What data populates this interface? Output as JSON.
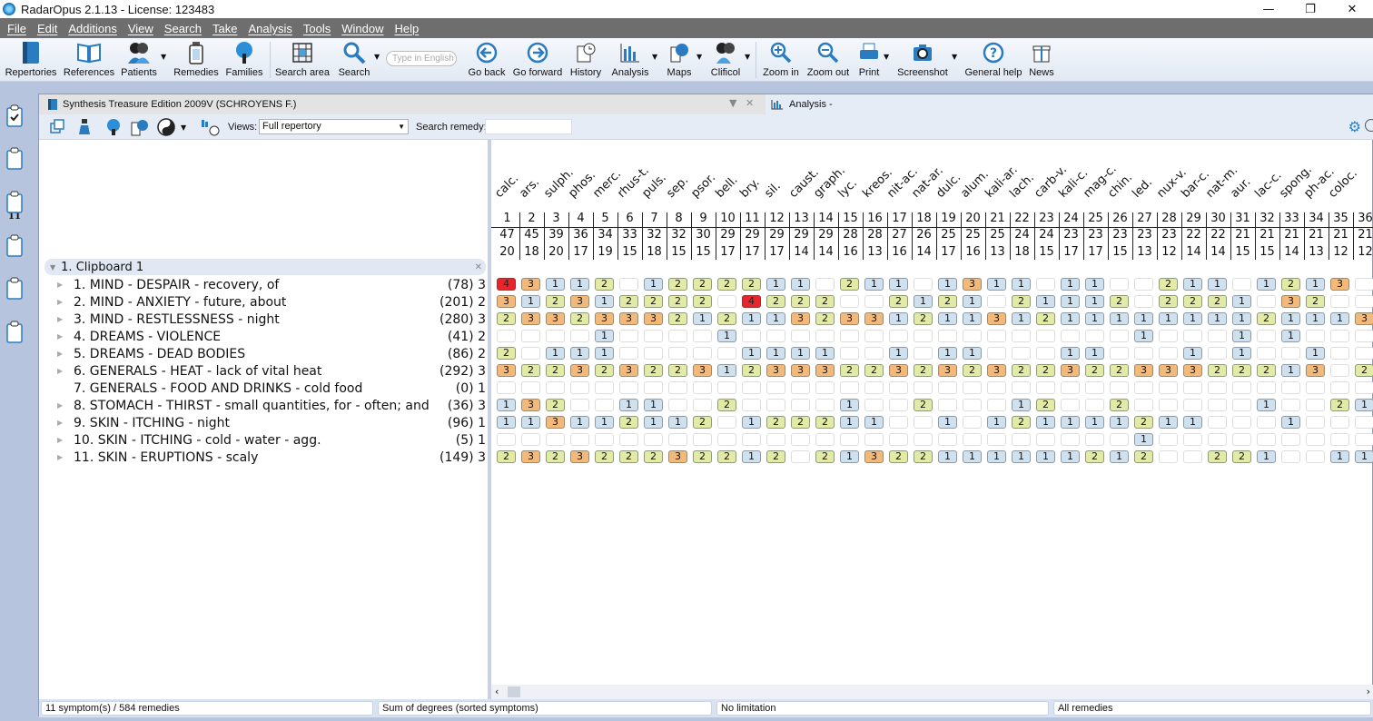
{
  "app": {
    "title": "RadarOpus 2.1.13 - License: 123483"
  },
  "window_controls": {
    "minimize": "—",
    "restore": "❐",
    "close": "✕"
  },
  "menu": [
    "File",
    "Edit",
    "Additions",
    "View",
    "Search",
    "Take",
    "Analysis",
    "Tools",
    "Window",
    "Help"
  ],
  "toolbar": {
    "buttons": [
      {
        "label": "Repertories",
        "icon": "book-icon"
      },
      {
        "label": "References",
        "icon": "open-book-icon"
      },
      {
        "label": "Patients",
        "icon": "patients-icon"
      },
      {
        "label": "Remedies",
        "icon": "remedy-jar-icon"
      },
      {
        "label": "Families",
        "icon": "tree-icon"
      },
      {
        "label": "Search area",
        "icon": "search-area-icon"
      },
      {
        "label": "Search",
        "icon": "search-icon"
      },
      {
        "label": "Go back",
        "icon": "arrow-left-icon"
      },
      {
        "label": "Go forward",
        "icon": "arrow-right-icon"
      },
      {
        "label": "History",
        "icon": "history-icon"
      },
      {
        "label": "Analysis",
        "icon": "bar-chart-icon"
      },
      {
        "label": "Maps",
        "icon": "maps-icon"
      },
      {
        "label": "Clificol",
        "icon": "clificol-icon"
      },
      {
        "label": "Zoom in",
        "icon": "zoom-in-icon"
      },
      {
        "label": "Zoom out",
        "icon": "zoom-out-icon"
      },
      {
        "label": "Print",
        "icon": "printer-icon"
      },
      {
        "label": "Screenshot",
        "icon": "camera-icon"
      },
      {
        "label": "General help",
        "icon": "help-icon"
      },
      {
        "label": "News",
        "icon": "gift-icon"
      }
    ],
    "search_placeholder": "Type in English"
  },
  "sidebar": {
    "clipboard_count": "11"
  },
  "tabs": {
    "repertory": "Synthesis Treasure Edition 2009V (SCHROYENS F.)",
    "analysis": "Analysis -"
  },
  "subtoolbar": {
    "views_label": "Views:",
    "views_value": "Full repertory",
    "search_remedy_label": "Search remedy:",
    "search_remedy_value": ""
  },
  "clipboard": {
    "title": "1. Clipboard 1"
  },
  "symptoms": [
    {
      "name": "1. MIND - DESPAIR - recovery, of",
      "count": "(78) 3",
      "expandable": true
    },
    {
      "name": "2. MIND - ANXIETY - future, about",
      "count": "(201) 2",
      "expandable": true
    },
    {
      "name": "3. MIND - RESTLESSNESS - night",
      "count": "(280) 3",
      "expandable": true
    },
    {
      "name": "4. DREAMS - VIOLENCE",
      "count": "(41) 2",
      "expandable": true
    },
    {
      "name": "5. DREAMS - DEAD BODIES",
      "count": "(86) 2",
      "expandable": true
    },
    {
      "name": "6. GENERALS - HEAT - lack of vital heat",
      "count": "(292) 3",
      "expandable": true
    },
    {
      "name": "7. GENERALS - FOOD AND DRINKS - cold food",
      "count": "(0) 1",
      "expandable": false
    },
    {
      "name": "8. STOMACH - THIRST - small quantities, for - often; and",
      "count": "(36) 3",
      "expandable": true
    },
    {
      "name": "9. SKIN - ITCHING - night",
      "count": "(96) 1",
      "expandable": true
    },
    {
      "name": "10. SKIN - ITCHING - cold - water - agg.",
      "count": "(5) 1",
      "expandable": true
    },
    {
      "name": "11. SKIN - ERUPTIONS - scaly",
      "count": "(149) 3",
      "expandable": true
    }
  ],
  "remedies": [
    {
      "abbr": "calc.",
      "rank": "1",
      "score": "47",
      "hits": "20"
    },
    {
      "abbr": "ars.",
      "rank": "2",
      "score": "45",
      "hits": "18"
    },
    {
      "abbr": "sulph.",
      "rank": "3",
      "score": "39",
      "hits": "20"
    },
    {
      "abbr": "phos.",
      "rank": "4",
      "score": "36",
      "hits": "17"
    },
    {
      "abbr": "merc.",
      "rank": "5",
      "score": "34",
      "hits": "19"
    },
    {
      "abbr": "rhus-t.",
      "rank": "6",
      "score": "33",
      "hits": "15"
    },
    {
      "abbr": "puls.",
      "rank": "7",
      "score": "32",
      "hits": "18"
    },
    {
      "abbr": "sep.",
      "rank": "8",
      "score": "32",
      "hits": "15"
    },
    {
      "abbr": "psor.",
      "rank": "9",
      "score": "30",
      "hits": "15"
    },
    {
      "abbr": "bell.",
      "rank": "10",
      "score": "29",
      "hits": "17"
    },
    {
      "abbr": "bry.",
      "rank": "11",
      "score": "29",
      "hits": "17"
    },
    {
      "abbr": "sil.",
      "rank": "12",
      "score": "29",
      "hits": "17"
    },
    {
      "abbr": "caust.",
      "rank": "13",
      "score": "29",
      "hits": "14"
    },
    {
      "abbr": "graph.",
      "rank": "14",
      "score": "29",
      "hits": "14"
    },
    {
      "abbr": "lyc.",
      "rank": "15",
      "score": "28",
      "hits": "16"
    },
    {
      "abbr": "kreos.",
      "rank": "16",
      "score": "28",
      "hits": "13"
    },
    {
      "abbr": "nit-ac.",
      "rank": "17",
      "score": "27",
      "hits": "16"
    },
    {
      "abbr": "nat-ar.",
      "rank": "18",
      "score": "26",
      "hits": "14"
    },
    {
      "abbr": "dulc.",
      "rank": "19",
      "score": "25",
      "hits": "17"
    },
    {
      "abbr": "alum.",
      "rank": "20",
      "score": "25",
      "hits": "16"
    },
    {
      "abbr": "kali-ar.",
      "rank": "21",
      "score": "25",
      "hits": "13"
    },
    {
      "abbr": "lach.",
      "rank": "22",
      "score": "24",
      "hits": "18"
    },
    {
      "abbr": "carb-v.",
      "rank": "23",
      "score": "24",
      "hits": "15"
    },
    {
      "abbr": "kali-c.",
      "rank": "24",
      "score": "23",
      "hits": "17"
    },
    {
      "abbr": "mag-c.",
      "rank": "25",
      "score": "23",
      "hits": "17"
    },
    {
      "abbr": "chin.",
      "rank": "26",
      "score": "23",
      "hits": "15"
    },
    {
      "abbr": "led.",
      "rank": "27",
      "score": "23",
      "hits": "13"
    },
    {
      "abbr": "nux-v.",
      "rank": "28",
      "score": "23",
      "hits": "12"
    },
    {
      "abbr": "bar-c.",
      "rank": "29",
      "score": "22",
      "hits": "14"
    },
    {
      "abbr": "nat-m.",
      "rank": "30",
      "score": "22",
      "hits": "14"
    },
    {
      "abbr": "aur.",
      "rank": "31",
      "score": "21",
      "hits": "15"
    },
    {
      "abbr": "lac-c.",
      "rank": "32",
      "score": "21",
      "hits": "15"
    },
    {
      "abbr": "spong.",
      "rank": "33",
      "score": "21",
      "hits": "14"
    },
    {
      "abbr": "ph-ac.",
      "rank": "34",
      "score": "21",
      "hits": "13"
    },
    {
      "abbr": "coloc.",
      "rank": "35",
      "score": "21",
      "hits": "12"
    },
    {
      "abbr": "",
      "rank": "36",
      "score": "21",
      "hits": "12"
    }
  ],
  "grades": [
    [
      4,
      3,
      1,
      1,
      2,
      0,
      1,
      2,
      2,
      2,
      2,
      1,
      1,
      0,
      2,
      1,
      1,
      0,
      1,
      3,
      1,
      1,
      0,
      1,
      1,
      0,
      0,
      2,
      1,
      1,
      0,
      1,
      2,
      1,
      3,
      0
    ],
    [
      3,
      1,
      2,
      3,
      1,
      2,
      2,
      2,
      2,
      0,
      4,
      2,
      2,
      2,
      0,
      0,
      2,
      1,
      2,
      1,
      0,
      2,
      1,
      1,
      1,
      2,
      0,
      2,
      2,
      2,
      1,
      0,
      3,
      2,
      0,
      0
    ],
    [
      2,
      3,
      3,
      2,
      3,
      3,
      3,
      2,
      1,
      2,
      1,
      1,
      3,
      2,
      3,
      3,
      1,
      2,
      1,
      1,
      3,
      1,
      2,
      1,
      1,
      1,
      1,
      1,
      1,
      1,
      1,
      2,
      1,
      1,
      1,
      3
    ],
    [
      0,
      0,
      0,
      0,
      1,
      0,
      0,
      0,
      0,
      1,
      0,
      0,
      0,
      0,
      0,
      0,
      0,
      0,
      0,
      0,
      0,
      0,
      0,
      0,
      0,
      0,
      1,
      0,
      0,
      0,
      1,
      0,
      1,
      0,
      0,
      0
    ],
    [
      2,
      0,
      1,
      1,
      1,
      0,
      0,
      0,
      0,
      0,
      1,
      1,
      1,
      1,
      0,
      0,
      1,
      0,
      1,
      1,
      0,
      0,
      0,
      1,
      1,
      0,
      0,
      0,
      1,
      0,
      1,
      0,
      0,
      1,
      0,
      0
    ],
    [
      3,
      2,
      2,
      3,
      2,
      3,
      2,
      2,
      3,
      1,
      2,
      3,
      3,
      3,
      2,
      2,
      3,
      2,
      3,
      2,
      3,
      2,
      2,
      3,
      2,
      2,
      3,
      3,
      3,
      2,
      2,
      2,
      1,
      3,
      0,
      2
    ],
    [
      0,
      0,
      0,
      0,
      0,
      0,
      0,
      0,
      0,
      0,
      0,
      0,
      0,
      0,
      0,
      0,
      0,
      0,
      0,
      0,
      0,
      0,
      0,
      0,
      0,
      0,
      0,
      0,
      0,
      0,
      0,
      0,
      0,
      0,
      0,
      0
    ],
    [
      1,
      3,
      2,
      0,
      0,
      1,
      1,
      0,
      0,
      2,
      0,
      0,
      0,
      0,
      1,
      0,
      0,
      2,
      0,
      0,
      0,
      1,
      2,
      0,
      0,
      2,
      0,
      0,
      0,
      0,
      0,
      1,
      0,
      0,
      2,
      1
    ],
    [
      1,
      1,
      3,
      1,
      1,
      2,
      1,
      1,
      2,
      0,
      1,
      2,
      2,
      2,
      1,
      1,
      0,
      0,
      1,
      0,
      1,
      2,
      1,
      1,
      1,
      1,
      2,
      1,
      1,
      0,
      0,
      0,
      1,
      0,
      0,
      0
    ],
    [
      0,
      0,
      0,
      0,
      0,
      0,
      0,
      0,
      0,
      0,
      0,
      0,
      0,
      0,
      0,
      0,
      0,
      0,
      0,
      0,
      0,
      0,
      0,
      0,
      0,
      0,
      1,
      0,
      0,
      0,
      0,
      0,
      0,
      0,
      0,
      0
    ],
    [
      2,
      3,
      2,
      3,
      2,
      2,
      2,
      3,
      2,
      2,
      1,
      2,
      0,
      2,
      1,
      3,
      2,
      2,
      1,
      1,
      1,
      1,
      1,
      1,
      2,
      1,
      2,
      0,
      0,
      2,
      2,
      1,
      0,
      0,
      1,
      1
    ]
  ],
  "grade_colors": {
    "1": "#cfe0ee",
    "2": "#e3eaa6",
    "3": "#f3b97a",
    "4": "#e8252a"
  },
  "scrollbar": {
    "left": "‹",
    "right": "›"
  },
  "statusbar": {
    "symptoms": "11 symptom(s) / 584 remedies",
    "method": "Sum of degrees (sorted symptoms)",
    "limitation": "No limitation",
    "remedies": "All remedies"
  }
}
